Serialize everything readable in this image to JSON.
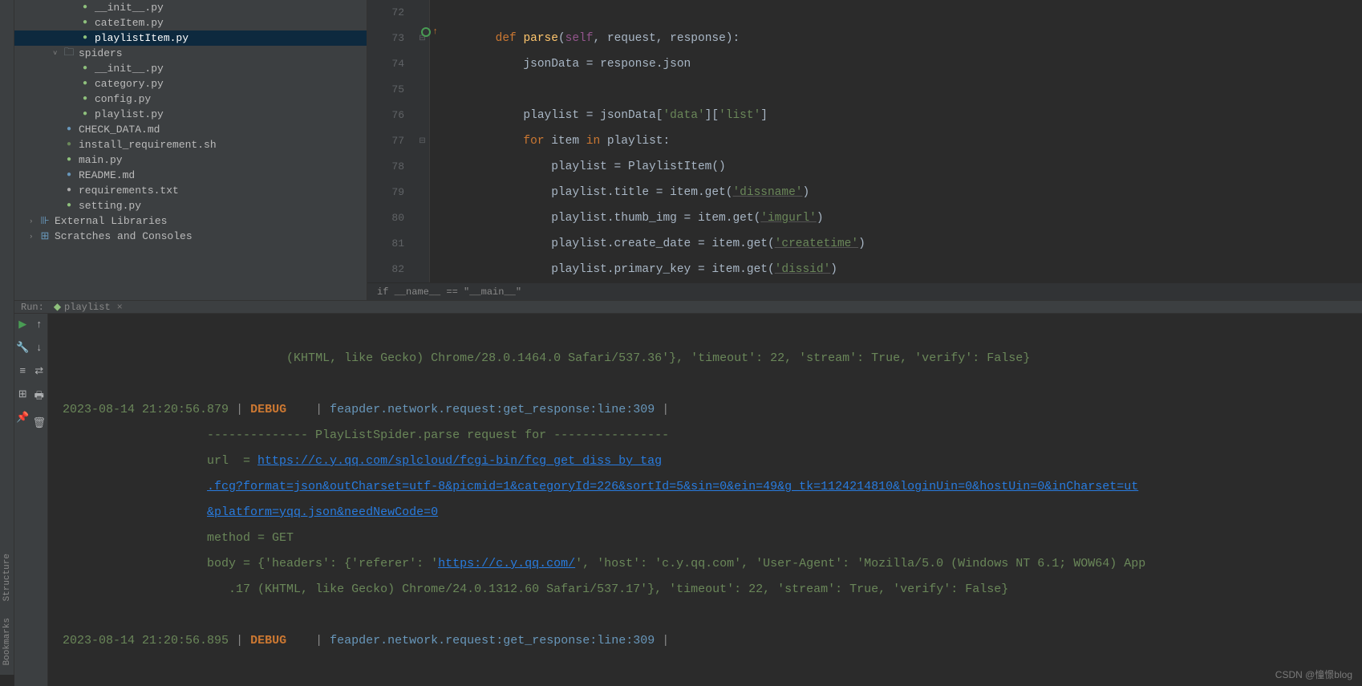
{
  "tree": {
    "items": [
      {
        "indent": 3,
        "icon": "py",
        "label": "__init__.py"
      },
      {
        "indent": 3,
        "icon": "py",
        "label": "cateItem.py"
      },
      {
        "indent": 3,
        "icon": "py",
        "label": "playlistItem.py",
        "selected": true
      },
      {
        "indent": 2,
        "icon": "folder",
        "label": "spiders",
        "arrow": "v"
      },
      {
        "indent": 3,
        "icon": "py",
        "label": "__init__.py"
      },
      {
        "indent": 3,
        "icon": "py",
        "label": "category.py"
      },
      {
        "indent": 3,
        "icon": "py",
        "label": "config.py"
      },
      {
        "indent": 3,
        "icon": "py",
        "label": "playlist.py"
      },
      {
        "indent": 2,
        "icon": "md",
        "label": "CHECK_DATA.md"
      },
      {
        "indent": 2,
        "icon": "sh",
        "label": "install_requirement.sh"
      },
      {
        "indent": 2,
        "icon": "py",
        "label": "main.py"
      },
      {
        "indent": 2,
        "icon": "md",
        "label": "README.md"
      },
      {
        "indent": 2,
        "icon": "txt",
        "label": "requirements.txt"
      },
      {
        "indent": 2,
        "icon": "py",
        "label": "setting.py"
      }
    ],
    "ext_lib": "External Libraries",
    "scratches": "Scratches and Consoles"
  },
  "editor": {
    "lines_start": 72,
    "lines_end": 82,
    "breadcrumb": "if __name__ == \"__main__\""
  },
  "code": {
    "l72": "",
    "l73_def": "def ",
    "l73_fn": "parse",
    "l73_open": "(",
    "l73_self": "self",
    "l73_rest": ", request, response):",
    "l74": "            jsonData = response.json",
    "l75": "",
    "l76_a": "            playlist = jsonData[",
    "l76_s1": "'data'",
    "l76_b": "][",
    "l76_s2": "'list'",
    "l76_c": "]",
    "l77_for": "for ",
    "l77_item": "item ",
    "l77_in": "in ",
    "l77_rest": "playlist:",
    "l78": "                playlist = PlaylistItem()",
    "l79_a": "                playlist.title = item.get(",
    "l79_s": "'dissname'",
    "l79_b": ")",
    "l80_a": "                playlist.thumb_img = item.get(",
    "l80_s": "'imgurl'",
    "l80_b": ")",
    "l81_a": "                playlist.create_date = item.get(",
    "l81_s": "'createtime'",
    "l81_b": ")",
    "l82_a": "                playlist.primary_key = item.get(",
    "l82_s": "'dissid'",
    "l82_b": ")"
  },
  "run": {
    "title": "Run:",
    "tab": "playlist"
  },
  "console": {
    "line1": "       (KHTML, like Gecko) Chrome/28.0.1464.0 Safari/537.36'}, 'timeout': 22, 'stream': True, 'verify': False}",
    "ts1": "2023-08-14 21:20:56.879",
    "debug": "DEBUG",
    "src": "feapder.network.request",
    "fn": "get_response",
    "ln": "line:309",
    "parse_header": "-------------- PlayListSpider.parse request for ----------------",
    "url_label": "url  = ",
    "url1": "https://c.y.qq.com/splcloud/fcgi-bin/fcg_get_diss_by_tag",
    "url2": ".fcg?format=json&outCharset=utf-8&picmid=1&categoryId=226&sortId=5&sin=0&ein=49&g_tk=1124214810&loginUin=0&hostUin=0&inCharset=ut",
    "url3": "&platform=yqq.json&needNewCode=0",
    "method": "method = GET",
    "body1": "body = {'headers': {'referer': '",
    "body_link": "https://c.y.qq.com/",
    "body2": "', 'host': 'c.y.qq.com', 'User-Agent': 'Mozilla/5.0 (Windows NT 6.1; WOW64) App",
    "body3": ".17 (KHTML, like Gecko) Chrome/24.0.1312.60 Safari/537.17'}, 'timeout': 22, 'stream': True, 'verify': False}",
    "ts2": "2023-08-14 21:20:56.895"
  },
  "sidebar": {
    "structure": "Structure",
    "bookmarks": "Bookmarks"
  },
  "watermark": "CSDN @憧憬blog"
}
